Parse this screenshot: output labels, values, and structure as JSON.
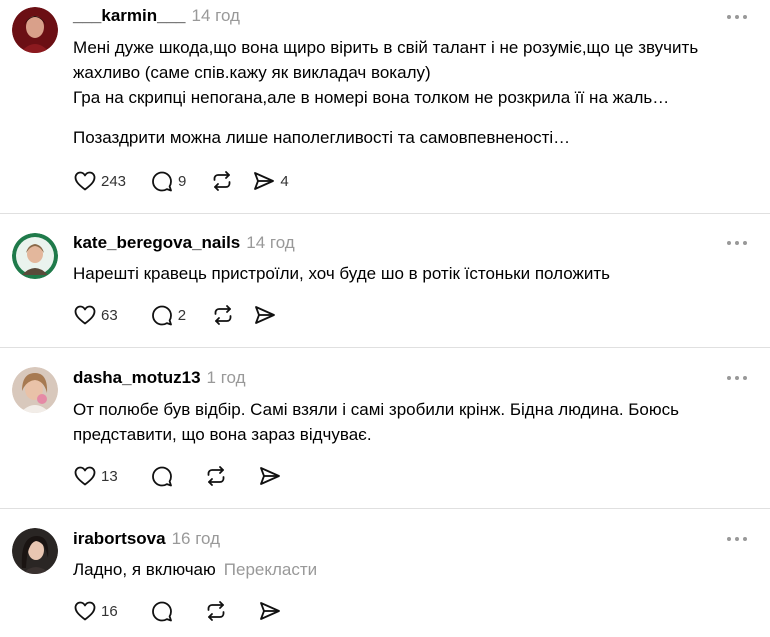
{
  "comments": [
    {
      "username": "___karmin___",
      "time": "14 год",
      "paragraphs": [
        "Мені дуже шкода,що вона щиро вірить в свій талант і не розуміє,що це звучить жахливо (саме спів.кажу як викладач вокалу)",
        "Гра на скрипці непогана,але в номері вона толком не розкрила її на жаль…",
        "Позаздрити можна лише наполегливості та самовпевненості…"
      ],
      "likes": "243",
      "replies": "9",
      "reposts": "",
      "shares": "4"
    },
    {
      "username": "kate_beregova_nails",
      "time": "14 год",
      "paragraphs": [
        "Нарешті кравець пристроїли, хоч буде шо в ротік їстоньки положить"
      ],
      "likes": "63",
      "replies": "2",
      "reposts": "",
      "shares": ""
    },
    {
      "username": "dasha_motuz13",
      "time": "1 год",
      "paragraphs": [
        "От полюбе був відбір. Самі взяли і самі зробили крінж. Бідна людина. Боюсь представити, що вона зараз відчуває."
      ],
      "likes": "13",
      "replies": "",
      "reposts": "",
      "shares": ""
    },
    {
      "username": "irabortsova",
      "time": "16 год",
      "paragraphs": [
        "Ладно, я включаю"
      ],
      "translate_label": "Перекласти",
      "likes": "16",
      "replies": "",
      "reposts": "",
      "shares": ""
    }
  ]
}
